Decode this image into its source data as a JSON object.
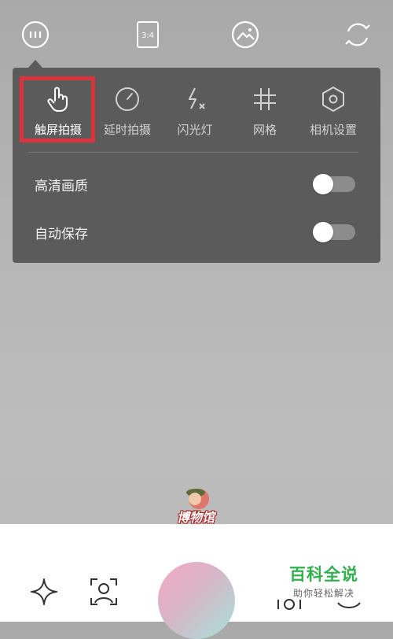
{
  "top_bar": {
    "menu_icon": "more-menu-icon",
    "ratio_label": "3:4",
    "gallery_icon": "gallery-icon",
    "switch_icon": "switch-camera-icon"
  },
  "panel": {
    "tools": [
      {
        "label": "触屏拍摄",
        "icon": "touch-hand-icon",
        "active": true
      },
      {
        "label": "延时拍摄",
        "icon": "timer-icon",
        "active": false
      },
      {
        "label": "闪光灯",
        "icon": "flash-off-icon",
        "active": false
      },
      {
        "label": "网格",
        "icon": "grid-icon",
        "active": false
      },
      {
        "label": "相机设置",
        "icon": "settings-hex-icon",
        "active": false
      }
    ],
    "settings": [
      {
        "label": "高清画质",
        "enabled": false
      },
      {
        "label": "自动保存",
        "enabled": false
      }
    ],
    "highlight_color": "#d9343b"
  },
  "watermark": {
    "text": "博物馆"
  },
  "bottom_bar": {
    "left_icons": [
      "sparkle-icon",
      "face-frame-icon"
    ],
    "right_icons": [
      "filter-icon",
      "beauty-icon"
    ],
    "brand_title": "百科全说",
    "brand_subtitle": "助你轻松解决",
    "brand_color": "#2fb24c"
  }
}
